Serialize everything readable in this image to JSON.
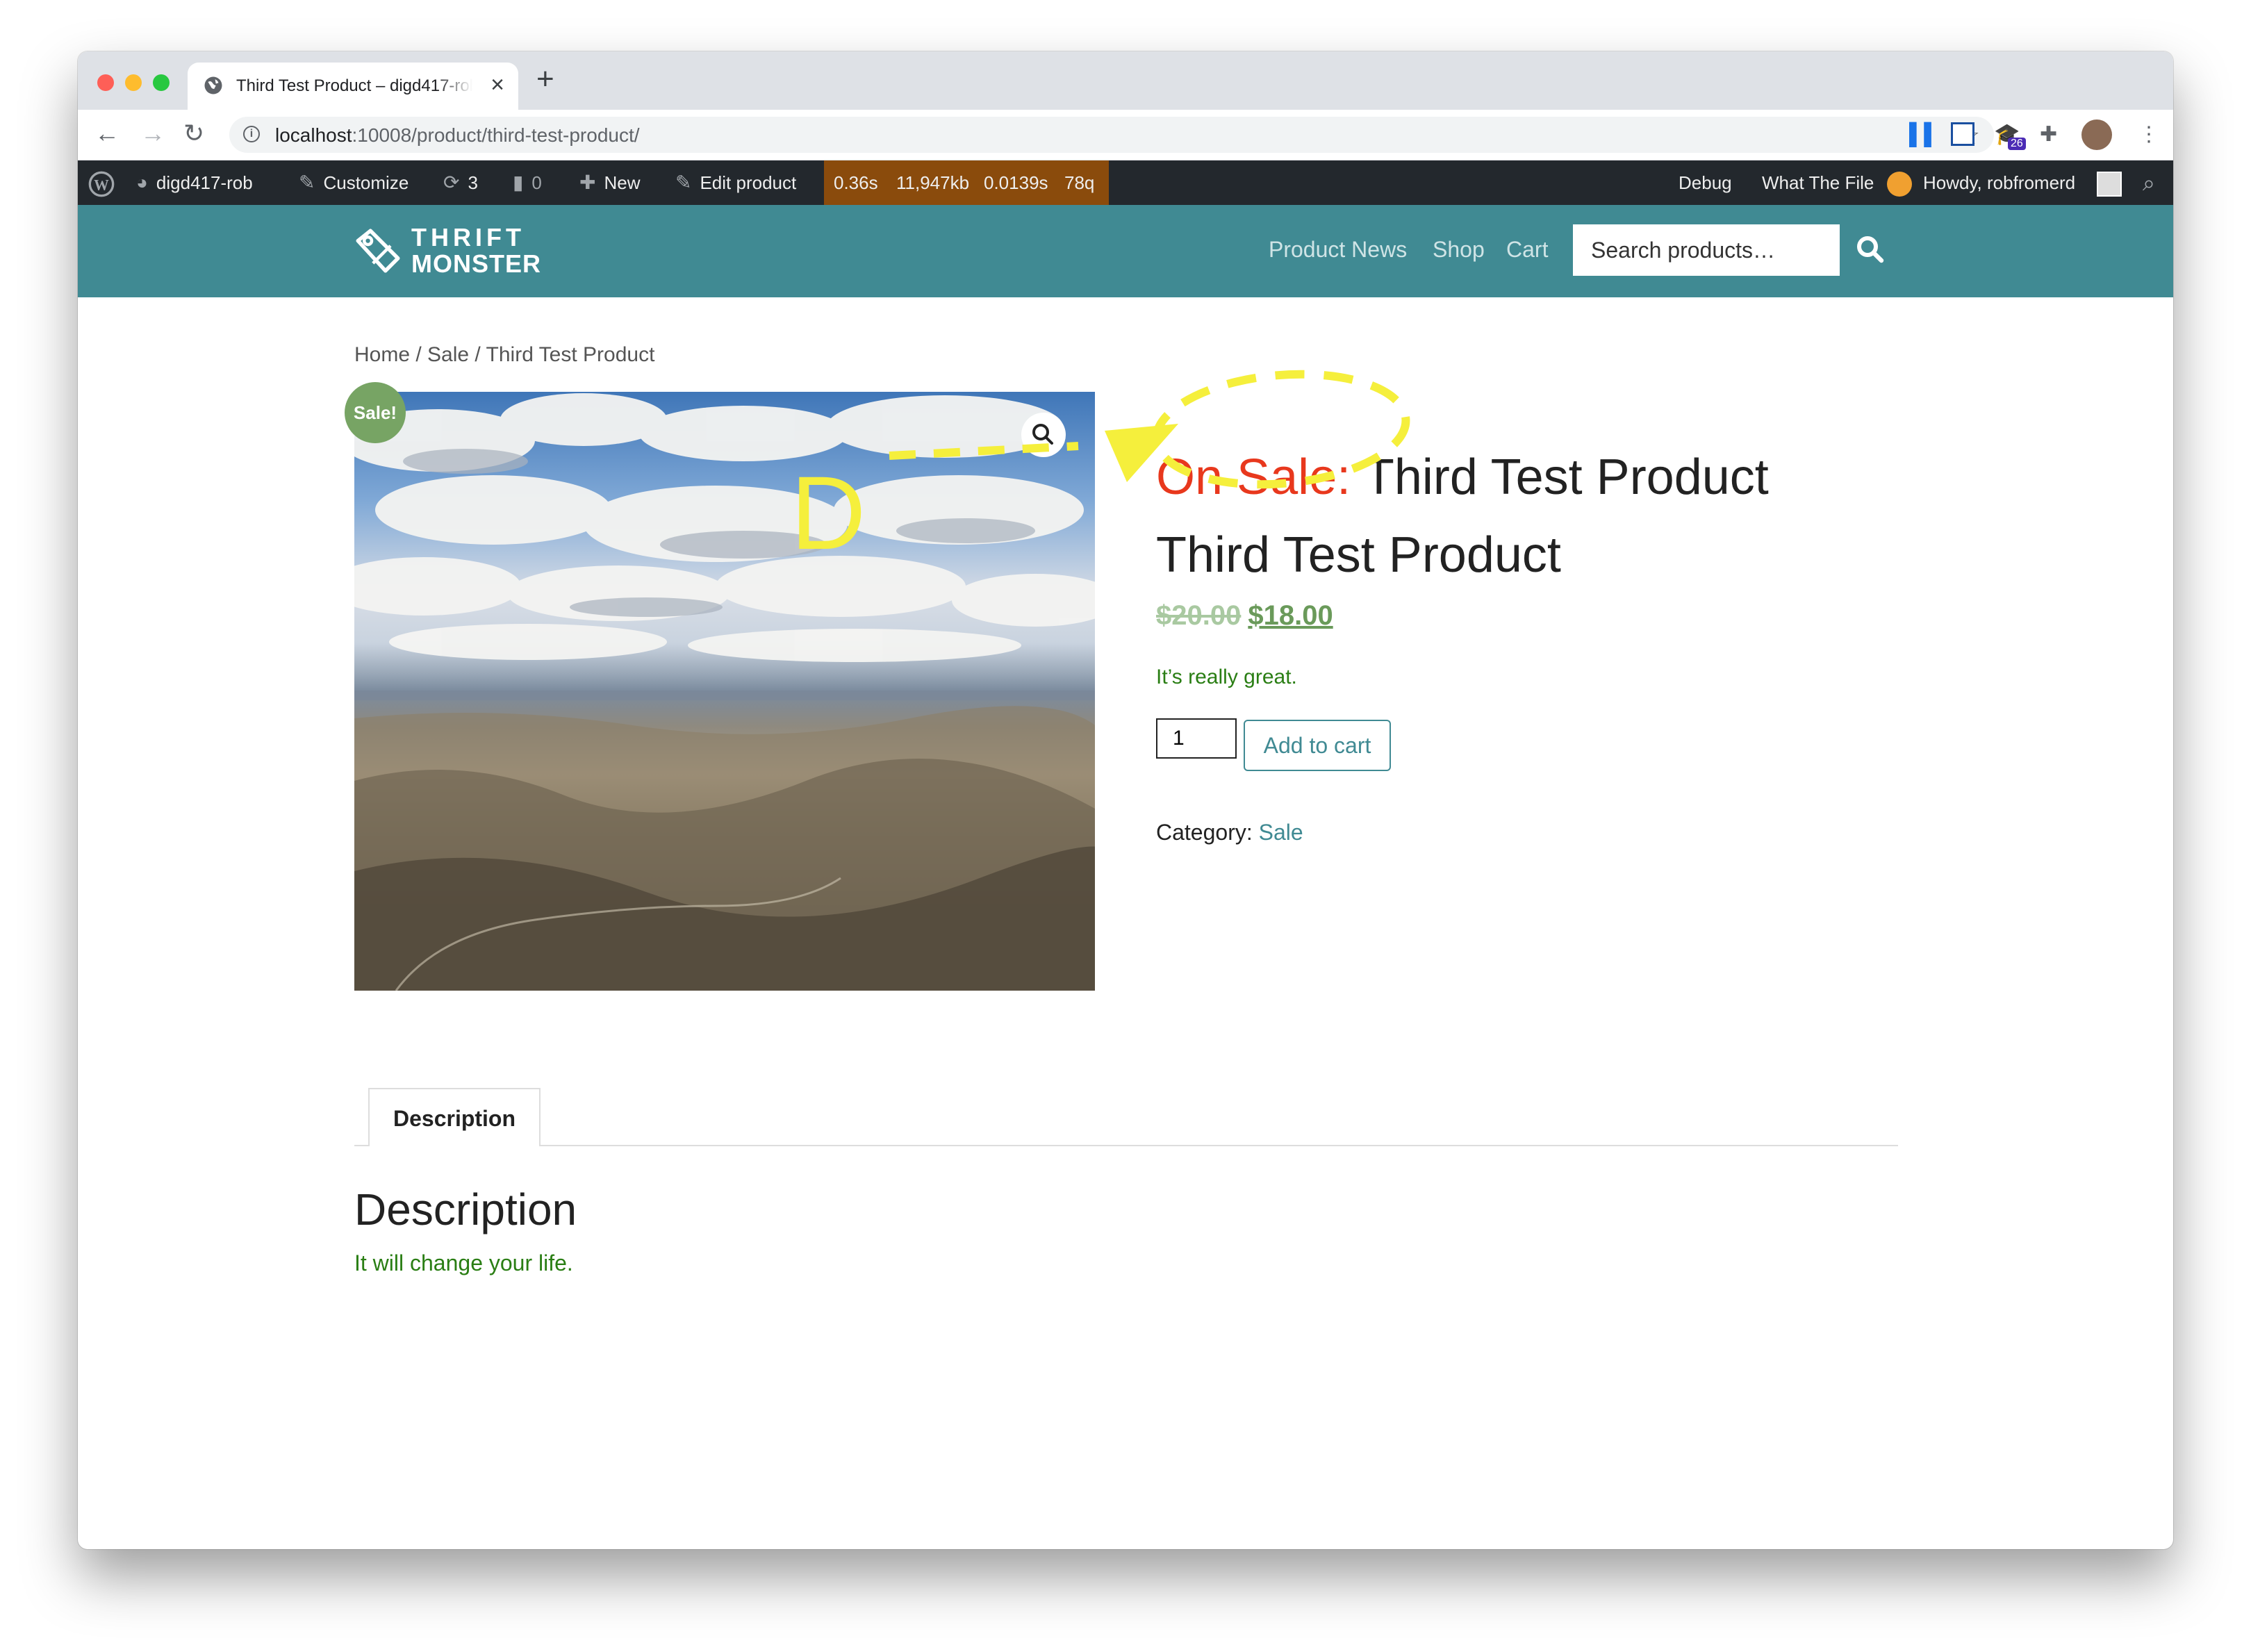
{
  "browser": {
    "tab_title": "Third Test Product – digd417-rob",
    "new_tab_label": "+",
    "url_host": "localhost",
    "url_path": ":10008/product/third-test-product/",
    "extension_badge": "26"
  },
  "adminbar": {
    "site_name": "digd417-rob",
    "customize": "Customize",
    "updates_count": "3",
    "comments_count": "0",
    "new_label": "New",
    "edit_label": "Edit product",
    "qm_time": "0.36s",
    "qm_memory": "11,947kb",
    "qm_query_time": "0.0139s",
    "qm_queries": "78q",
    "debug_label": "Debug",
    "what_the_file": "What The File",
    "howdy": "Howdy, robfromerd"
  },
  "site": {
    "logo_line1": "THRIFT",
    "logo_line2": "MONSTER",
    "nav": [
      "Product News",
      "Shop",
      "Cart"
    ],
    "search_placeholder": "Search products…"
  },
  "product": {
    "breadcrumb": "Home / Sale / Third Test Product",
    "sale_badge": "Sale!",
    "title_prefix": "On Sale:",
    "title": "Third Test Product",
    "title_repeat": "Third Test Product",
    "regular_price": "$20.00",
    "sale_price": "$18.00",
    "short_description": "It’s really great.",
    "quantity": "1",
    "add_to_cart": "Add to cart",
    "category_label": "Category:",
    "category": "Sale"
  },
  "tabs": {
    "description_tab": "Description",
    "description_heading": "Description",
    "description_body": "It will change your life."
  },
  "annotation": {
    "letter": "D",
    "color": "#f5ef3c"
  }
}
